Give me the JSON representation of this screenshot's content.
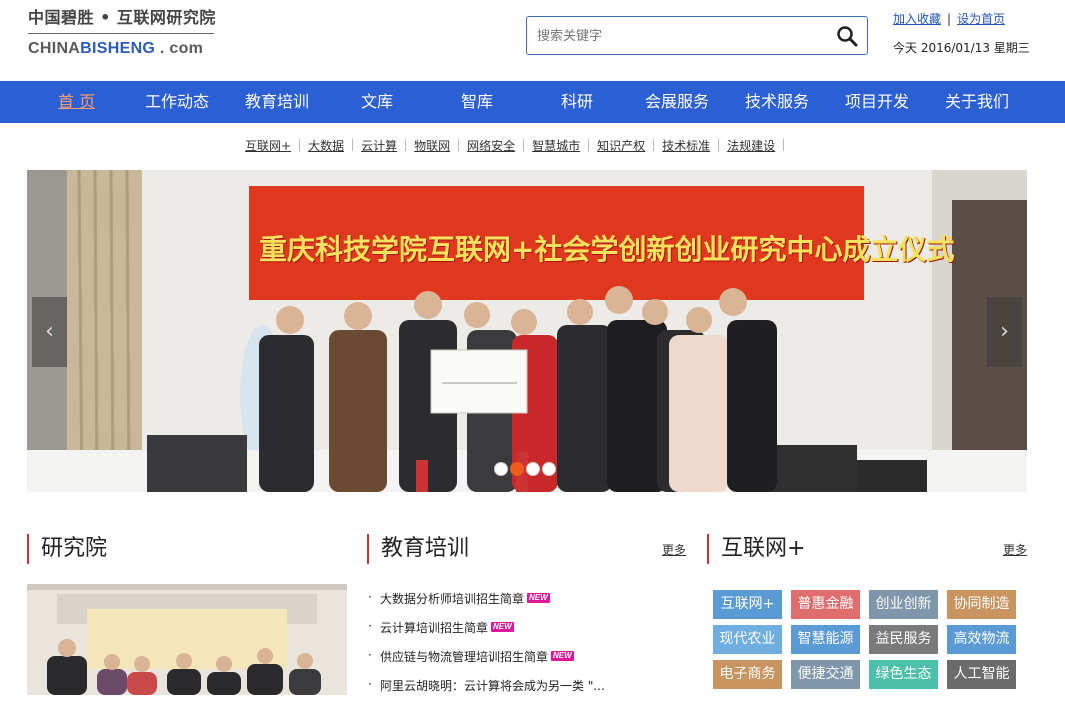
{
  "header": {
    "logo_cn": "中国碧胜 • 互联网研究院",
    "logo_en_a": "CHINA",
    "logo_en_b": "BISHENG",
    "logo_en_c": " . com",
    "search_placeholder": "搜索关键字",
    "add_favorite": "加入收藏",
    "separator": "|",
    "set_homepage": "设为首页",
    "date": "今天 2016/01/13 星期三"
  },
  "nav": [
    "首 页",
    "工作动态",
    "教育培训",
    "文库",
    "智库",
    "科研",
    "会展服务",
    "技术服务",
    "项目开发",
    "关于我们"
  ],
  "subnav": [
    "互联网+",
    "大数据",
    "云计算",
    "物联网",
    "网络安全",
    "智慧城市",
    "知识产权",
    "技术标准",
    "法规建设"
  ],
  "banner": {
    "banner_text": "重庆科技学院互联网+社会学创新创业研究中心成立仪式",
    "slides": 4,
    "active_slide": 2,
    "prev": "‹",
    "next": "›"
  },
  "sections": {
    "institute": {
      "title": "研究院"
    },
    "education": {
      "title": "教育培训",
      "more": "更多",
      "items": [
        {
          "text": "大数据分析师培训招生简章",
          "badge": "NEW"
        },
        {
          "text": "云计算培训招生简章",
          "badge": "NEW"
        },
        {
          "text": "供应链与物流管理培训招生简章",
          "badge": "NEW"
        },
        {
          "text": "阿里云胡晓明：云计算将会成为另一类 \"...",
          "badge": ""
        }
      ]
    },
    "internet": {
      "title": "互联网+",
      "more": "更多",
      "tags": [
        {
          "label": "互联网+",
          "color": "#5b9bd5"
        },
        {
          "label": "普惠金融",
          "color": "#e06d6d"
        },
        {
          "label": "创业创新",
          "color": "#7f96ab"
        },
        {
          "label": "协同制造",
          "color": "#c9945f"
        },
        {
          "label": "现代农业",
          "color": "#6faee0"
        },
        {
          "label": "智慧能源",
          "color": "#5b9bd5"
        },
        {
          "label": "益民服务",
          "color": "#7a7a7a"
        },
        {
          "label": "高效物流",
          "color": "#5b9bd5"
        },
        {
          "label": "电子商务",
          "color": "#c9945f"
        },
        {
          "label": "便捷交通",
          "color": "#7f96ab"
        },
        {
          "label": "绿色生态",
          "color": "#4cc0a8"
        },
        {
          "label": "人工智能",
          "color": "#6b6b6b"
        }
      ]
    }
  }
}
